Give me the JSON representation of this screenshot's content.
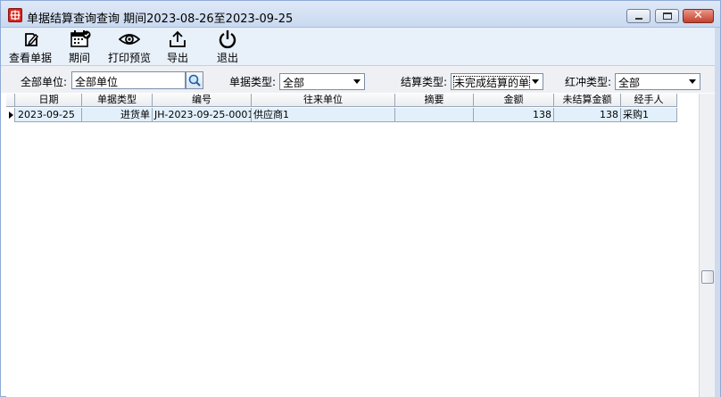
{
  "window": {
    "title": "单据结算查询查询 期间2023-08-26至2023-09-25"
  },
  "toolbar": {
    "view_doc": "查看单据",
    "period": "期间",
    "print_preview": "打印预览",
    "export": "导出",
    "exit": "退出"
  },
  "filters": {
    "unit_label": "全部单位:",
    "unit_value": "全部单位",
    "doc_type_label": "单据类型:",
    "doc_type_value": "全部",
    "settle_type_label": "结算类型:",
    "settle_type_value": "未完成结算的单",
    "reverse_type_label": "红冲类型:",
    "reverse_type_value": "全部"
  },
  "table": {
    "columns": [
      "日期",
      "单据类型",
      "编号",
      "往来单位",
      "摘要",
      "金额",
      "未结算金额",
      "经手人"
    ],
    "rows": [
      {
        "date": "2023-09-25",
        "doc_type": "进货单",
        "number": "JH-2023-09-25-0001",
        "partner": "供应商1",
        "summary": "",
        "amount": "138",
        "unsettled": "138",
        "handler": "采购1"
      }
    ]
  }
}
